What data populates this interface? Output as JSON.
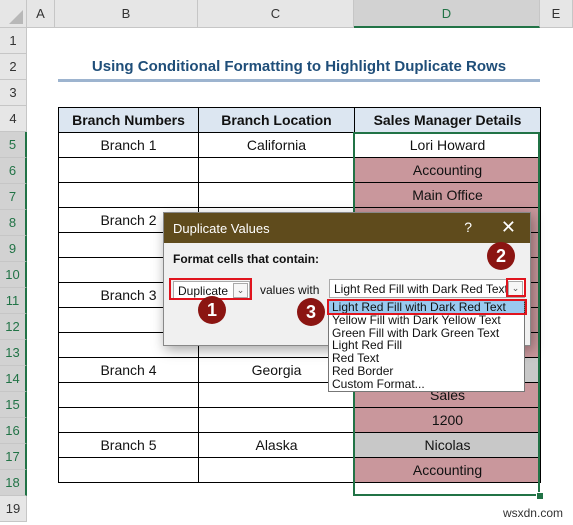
{
  "spreadsheet": {
    "columns": [
      "A",
      "B",
      "C",
      "D",
      "E"
    ],
    "selected_column": "D",
    "rows": [
      "1",
      "2",
      "3",
      "4",
      "5",
      "6",
      "7",
      "8",
      "9",
      "10",
      "11",
      "12",
      "13",
      "14",
      "15",
      "16",
      "17",
      "18",
      "19"
    ],
    "title": "Using Conditional Formatting to Highlight Duplicate Rows",
    "table": {
      "headers": [
        "Branch Numbers",
        "Branch Location",
        "Sales Manager Details"
      ],
      "rows": [
        {
          "branch": "Branch 1",
          "location": "California",
          "details": "Lori Howard",
          "fill": "none"
        },
        {
          "branch": "",
          "location": "",
          "details": "Accounting",
          "fill": "red"
        },
        {
          "branch": "",
          "location": "",
          "details": "Main Office",
          "fill": "red"
        },
        {
          "branch": "Branch 2",
          "location": "",
          "details": "",
          "fill": "red"
        },
        {
          "branch": "",
          "location": "",
          "details": "",
          "fill": "red"
        },
        {
          "branch": "",
          "location": "",
          "details": "",
          "fill": "red"
        },
        {
          "branch": "Branch 3",
          "location": "",
          "details": "",
          "fill": "red"
        },
        {
          "branch": "",
          "location": "",
          "details": "",
          "fill": "red"
        },
        {
          "branch": "",
          "location": "",
          "details": "",
          "fill": "red"
        },
        {
          "branch": "Branch 4",
          "location": "Georgia",
          "details": "",
          "fill": "gray"
        },
        {
          "branch": "",
          "location": "",
          "details": "Sales",
          "fill": "red"
        },
        {
          "branch": "",
          "location": "",
          "details": "1200",
          "fill": "red"
        },
        {
          "branch": "Branch 5",
          "location": "Alaska",
          "details": "Nicolas",
          "fill": "gray"
        },
        {
          "branch": "",
          "location": "",
          "details": "Accounting",
          "fill": "red"
        }
      ]
    }
  },
  "dialog": {
    "title": "Duplicate Values",
    "help": "?",
    "close": "✕",
    "label": "Format cells that contain:",
    "type_value": "Duplicate",
    "values_with": "values with",
    "format_value": "Light Red Fill with Dark Red Text",
    "options": [
      "Light Red Fill with Dark Red Text",
      "Yellow Fill with Dark Yellow Text",
      "Green Fill with Dark Green Text",
      "Light Red Fill",
      "Red Text",
      "Red Border",
      "Custom Format..."
    ],
    "selected_option_index": 0
  },
  "annotations": {
    "step1": "1",
    "step2": "2",
    "step3": "3"
  },
  "colors": {
    "duplicate_fill": "#c9979c",
    "duplicate_text": "#8b1a1a",
    "dialog_title": "#5f4b1c",
    "selection": "#217346",
    "callout_red": "#e0141e",
    "badge": "#8b1512"
  },
  "watermark": "wsxdn.com"
}
